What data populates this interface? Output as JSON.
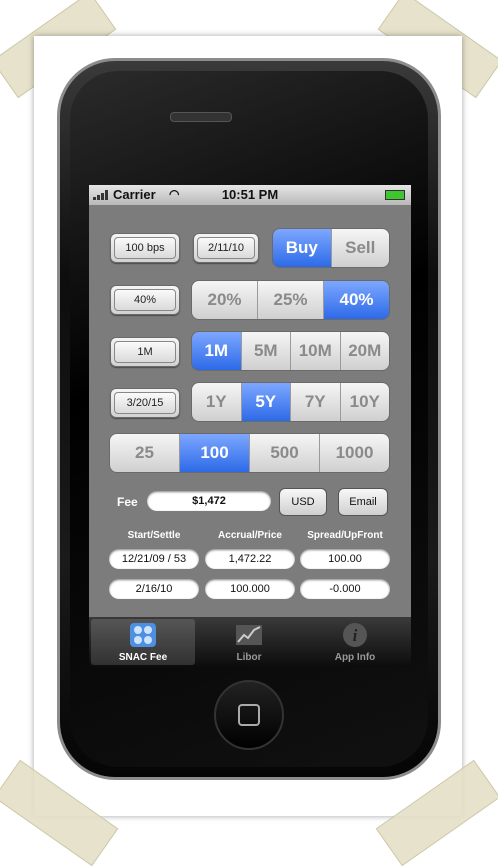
{
  "status_bar": {
    "carrier": "Carrier",
    "time": "10:51 PM"
  },
  "rows": {
    "spread_button": "100 bps",
    "date_button": "2/11/10",
    "side": {
      "options": [
        "Buy",
        "Sell"
      ],
      "selected": "Buy"
    },
    "recovery_button": "40%",
    "recovery": {
      "options": [
        "20%",
        "25%",
        "40%"
      ],
      "selected": "40%"
    },
    "notional_button": "1M",
    "notional": {
      "options": [
        "1M",
        "5M",
        "10M",
        "20M"
      ],
      "selected": "1M"
    },
    "maturity_button": "3/20/15",
    "tenor": {
      "options": [
        "1Y",
        "5Y",
        "7Y",
        "10Y"
      ],
      "selected": "5Y"
    },
    "coupon": {
      "options": [
        "25",
        "100",
        "500",
        "1000"
      ],
      "selected": "100"
    }
  },
  "fee": {
    "label": "Fee",
    "value": "$1,472",
    "currency_button": "USD",
    "email_button": "Email"
  },
  "results": {
    "headers": [
      "Start/Settle",
      "Accrual/Price",
      "Spread/UpFront"
    ],
    "row1": [
      "12/21/09 / 53",
      "1,472.22",
      "100.00"
    ],
    "row2": [
      "2/16/10",
      "100.000",
      "-0.000"
    ]
  },
  "tabbar": {
    "tabs": [
      {
        "label": "SNAC Fee",
        "icon": "calculator-icon"
      },
      {
        "label": "Libor",
        "icon": "chart-icon"
      },
      {
        "label": "App Info",
        "icon": "info-icon"
      }
    ],
    "selected": "SNAC Fee"
  },
  "colors": {
    "selected_segment": "#2d6ae8",
    "screen_background": "#7c7c7c"
  }
}
